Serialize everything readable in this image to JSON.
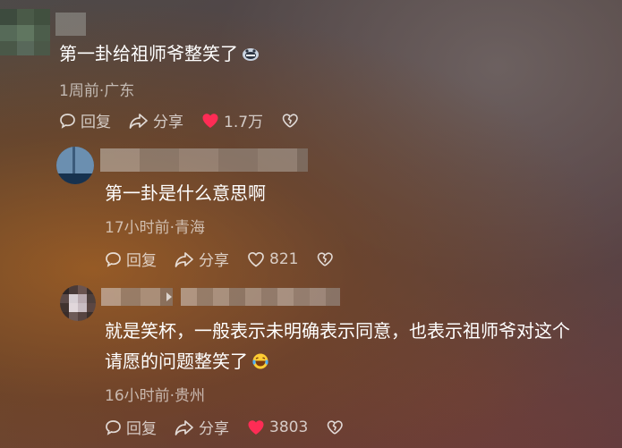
{
  "comments": [
    {
      "text": "第一卦给祖师爷整笑了",
      "meta": "1周前·广东",
      "reply_label": "回复",
      "share_label": "分享",
      "likes": "1.7万",
      "liked": true
    },
    {
      "text": "第一卦是什么意思啊",
      "meta": "17小时前·青海",
      "reply_label": "回复",
      "share_label": "分享",
      "likes": "821",
      "liked": false
    },
    {
      "text_line1": "就是笑杯，一般表示未明确表示同意，也表示祖师爷对这个",
      "text_line2": "请愿的问题整笑了",
      "meta": "16小时前·贵州",
      "reply_label": "回复",
      "share_label": "分享",
      "likes": "3803",
      "liked": true
    }
  ],
  "colors": {
    "like_active": "#fe2c55",
    "icon": "#ffffffb8"
  },
  "icons": [
    "reply-icon",
    "share-icon",
    "heart-icon",
    "dislike-icon",
    "emoji-grin-icon",
    "emoji-laugh-cry-icon",
    "reply-arrow-icon"
  ]
}
